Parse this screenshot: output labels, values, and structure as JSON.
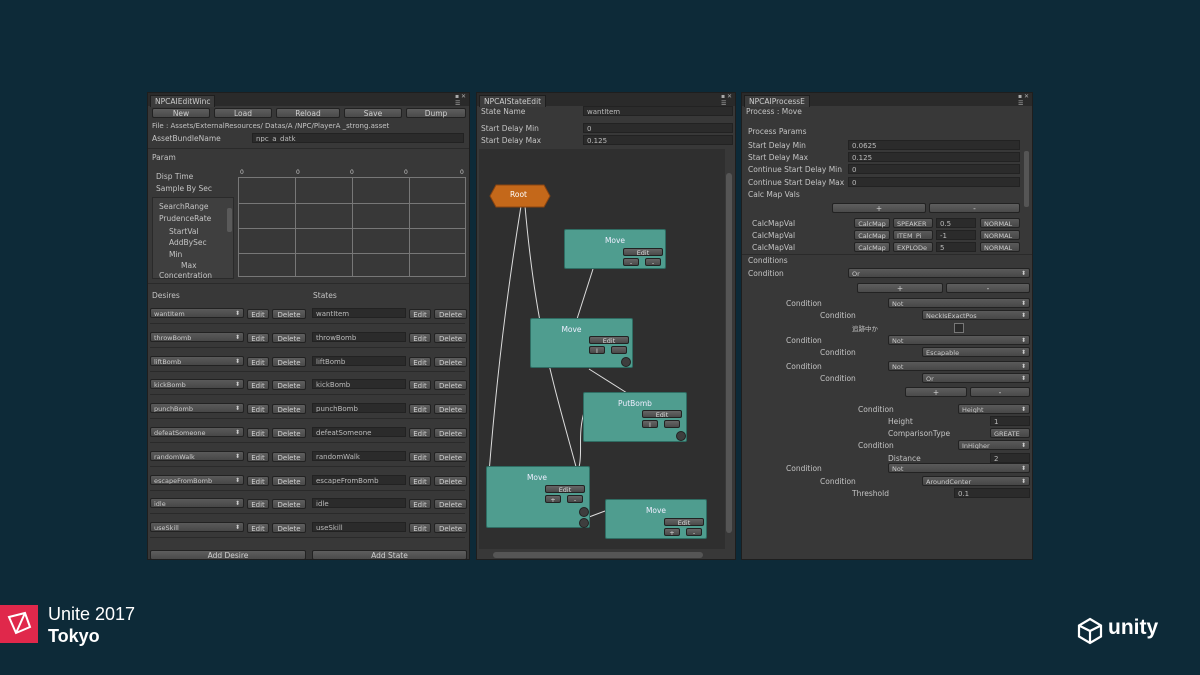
{
  "left_panel": {
    "tab": "NPCAIEditWinc",
    "toolbar": [
      "New",
      "Load",
      "Reload",
      "Save",
      "Dump"
    ],
    "file_path": "File : Assets/ExternalResources/ Datas/A /NPC/PlayerA _strong.asset",
    "asset_bundle_label": "AssetBundleName",
    "asset_bundle_value": "npc_a_datk",
    "param_header": "Param",
    "disp_time_label": "Disp Time",
    "sample_by_sec_label": "Sample By Sec",
    "params_list": [
      "SearchRange",
      "PrudenceRate",
      "StartVal",
      "AddBySec",
      "Min",
      "Max",
      "Concentration"
    ],
    "graph_ticks": [
      "0",
      "0",
      "0",
      "0",
      "0"
    ],
    "desires_header": "Desires",
    "states_header": "States",
    "edit_label": "Edit",
    "delete_label": "Delete",
    "rows": [
      {
        "desire": "wantItem",
        "state": "wantItem"
      },
      {
        "desire": "throwBomb",
        "state": "throwBomb"
      },
      {
        "desire": "liftBomb",
        "state": "liftBomb"
      },
      {
        "desire": "kickBomb",
        "state": "kickBomb"
      },
      {
        "desire": "punchBomb",
        "state": "punchBomb"
      },
      {
        "desire": "defeatSomeone",
        "state": "defeatSomeone"
      },
      {
        "desire": "randomWalk",
        "state": "randomWalk"
      },
      {
        "desire": "escapeFromBomb",
        "state": "escapeFromBomb"
      },
      {
        "desire": "idle",
        "state": "idle"
      },
      {
        "desire": "useSkill",
        "state": "useSkill"
      }
    ],
    "add_desire": "Add Desire",
    "add_state": "Add State"
  },
  "middle_panel": {
    "tab": "NPCAIStateEdit",
    "state_name_label": "State Name",
    "state_name_value": "wantItem",
    "start_delay_min_label": "Start Delay Min",
    "start_delay_min_value": "0",
    "start_delay_max_label": "Start Delay Max",
    "start_delay_max_value": "0.125",
    "root_label": "Root",
    "nodes": [
      {
        "title": "Move",
        "edit": "Edit",
        "a": "-",
        "b": "-"
      },
      {
        "title": "Move",
        "edit": "Edit",
        "a": "I",
        "b": ""
      },
      {
        "title": "PutBomb",
        "edit": "Edit",
        "a": "I",
        "b": ""
      },
      {
        "title": "Move",
        "edit": "Edit",
        "a": "+",
        "b": "-"
      },
      {
        "title": "Move",
        "edit": "Edit",
        "a": "+",
        "b": "-"
      }
    ]
  },
  "right_panel": {
    "tab": "NPCAIProcessE",
    "process_label": "Process : Move",
    "process_params_header": "Process Params",
    "params": [
      {
        "label": "Start Delay Min",
        "value": "0.0625"
      },
      {
        "label": "Start Delay Max",
        "value": "0.125"
      },
      {
        "label": "Continue Start Delay Min",
        "value": "0"
      },
      {
        "label": "Continue Start Delay Max",
        "value": "0"
      }
    ],
    "calc_map_vals_label": "Calc Map Vals",
    "plus": "+",
    "minus": "-",
    "calc_rows": [
      {
        "label": "CalcMapVal",
        "btn": "CalcMap",
        "type": "SPEAKER",
        "val": "0.5",
        "mode": "NORMAL"
      },
      {
        "label": "CalcMapVal",
        "btn": "CalcMap",
        "type": "ITEM_Pi",
        "val": "-1",
        "mode": "NORMAL"
      },
      {
        "label": "CalcMapVal",
        "btn": "CalcMap",
        "type": "EXPLODe",
        "val": "5",
        "mode": "NORMAL"
      }
    ],
    "conditions_header": "Conditions",
    "cond_top_label": "Condition",
    "cond_top_value": "Or",
    "c1_label": "Condition",
    "c1_value": "Not",
    "c1_sub_label": "Condition",
    "c1_sub_value": "NeckIsExactPos",
    "jp_label": "追跡中か",
    "c2_label": "Condition",
    "c2_value": "Not",
    "c2_sub_label": "Condition",
    "c2_sub_value": "Escapable",
    "c3_label": "Condition",
    "c3_value": "Not",
    "c3_sub_label": "Condition",
    "c3_sub_value": "Or",
    "c3_inner_label": "Condition",
    "c3_inner_value": "Height",
    "height_label": "Height",
    "height_value": "1",
    "comparison_label": "ComparisonType",
    "comparison_value": "GREATE",
    "c3_inner2_label": "Condition",
    "c3_inner2_value": "InHigher",
    "distance_label": "Distance",
    "distance_value": "2",
    "c4_label": "Condition",
    "c4_value": "Not",
    "c4_sub_label": "Condition",
    "c4_sub_value": "AroundCenter",
    "threshold_label": "Threshold",
    "threshold_value": "0.1"
  },
  "brand": {
    "event": "Unite 2017",
    "city": "Tokyo",
    "logo_text": "unity",
    "accent": "#e0284b",
    "background": "#0d2a38"
  }
}
